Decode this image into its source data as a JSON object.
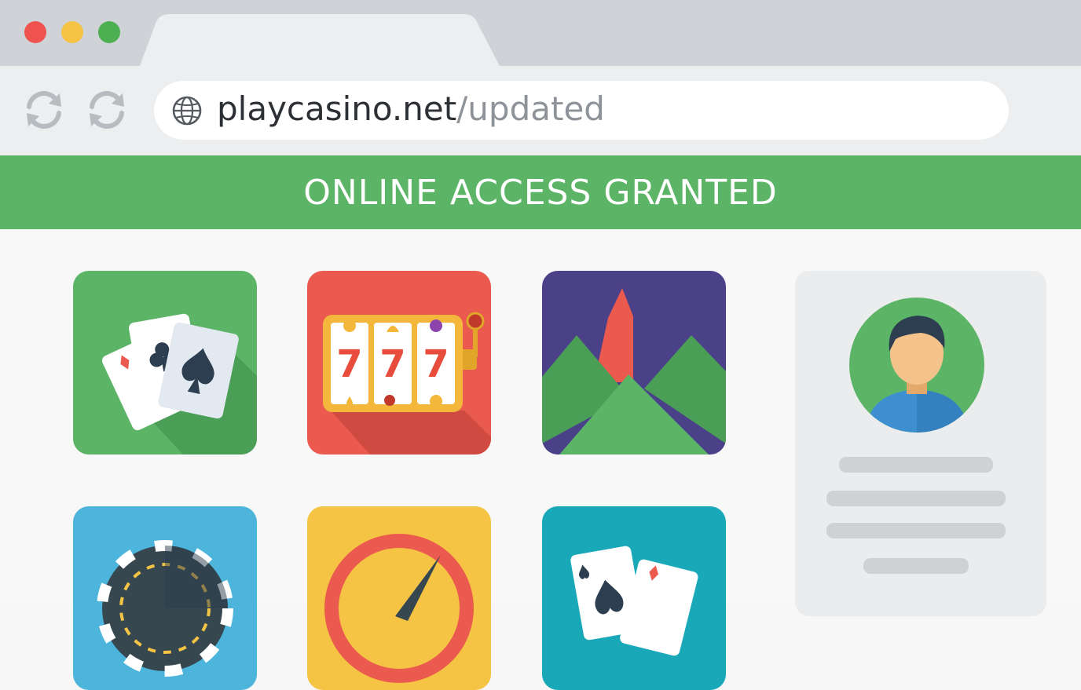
{
  "browser": {
    "window_controls": [
      {
        "name": "close",
        "color": "#ef5350"
      },
      {
        "name": "minimize",
        "color": "#f6c444"
      },
      {
        "name": "maximize",
        "color": "#4caf50"
      }
    ],
    "nav_icons": [
      "refresh-icon",
      "reload-icon"
    ],
    "address_bar": {
      "icon": "globe-icon",
      "host": "playcasino.net",
      "path": "/updated"
    }
  },
  "banner": {
    "text": "ONLINE ACCESS GRANTED",
    "color": "#5cb467"
  },
  "tiles": [
    {
      "name": "card-games",
      "icon": "playing-cards-icon",
      "color": "#5cb467"
    },
    {
      "name": "slots",
      "icon": "slot-machine-icon",
      "color": "#ea5a4e",
      "reel_symbols": [
        "7",
        "7",
        "7"
      ]
    },
    {
      "name": "mountain-game",
      "icon": "mountain-icon",
      "color": "#4a4188"
    },
    {
      "name": "poker-chips",
      "icon": "poker-chip-icon",
      "color": "#4db5dc"
    },
    {
      "name": "wheel",
      "icon": "speed-dial-icon",
      "color": "#f6c444"
    },
    {
      "name": "blackjack",
      "icon": "playing-cards-icon",
      "color": "#19a8b8"
    }
  ],
  "profile": {
    "avatar_icon": "user-avatar-icon",
    "avatar_color": "#5cb467"
  }
}
